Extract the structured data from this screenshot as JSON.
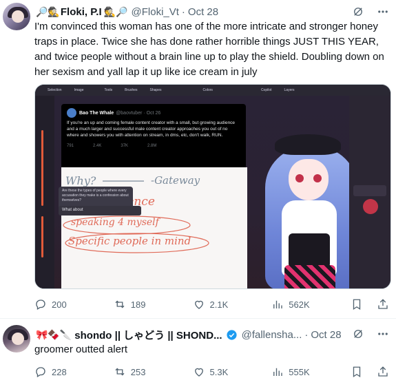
{
  "tweets": [
    {
      "author": {
        "emoji_prefix": "🔎🕵",
        "display_name": "Floki, P.I",
        "emoji_suffix": "🕵🔎",
        "handle": "@Floki_Vt",
        "verified": false
      },
      "date": "Oct 28",
      "text": "I'm convinced this woman has one of the more intricate and stronger honey traps in place. Twice she has done rather horrible things JUST THIS YEAR, and twice people without a brain line up to play the shield.  Doubling down on her sexism and yall lap it up like ice cream in july",
      "media": {
        "toolbar": [
          "Selection",
          "Image",
          "Tools",
          "Brushes",
          "Shapes",
          "Colors",
          "Copilot",
          "Layers"
        ],
        "embedded_tweet": {
          "name": "Bao The Whale",
          "handle": "@baovtuber · Oct 26",
          "body": "If you're an up and coming female content creator with a small, but growing audience and a much larger and successful male content creator approaches you out of no where and showers you with attention on stream, in dms, etc, don't walk, RUN.",
          "stats": [
            "791",
            "2.4K",
            "37K",
            "2.8M"
          ]
        },
        "handwriting": {
          "why": "Why?",
          "gateway": "-Gateway",
          "line1": "my experience",
          "line2": "speaking 4 myself",
          "line3": "Specific people in mind"
        },
        "chat_question": "Are these the types of people where every accusation they make is a confession about themselves?",
        "chat_reply": "What about"
      },
      "stats": {
        "replies": "200",
        "reposts": "189",
        "likes": "2.1K",
        "views": "562K"
      }
    },
    {
      "author": {
        "emoji_prefix": "🎀🍫🔪",
        "display_name": "shondo || しゃどう || SHOND...",
        "handle": "@fallensha...",
        "verified": true
      },
      "date": "Oct 28",
      "text": "groomer outted alert",
      "stats": {
        "replies": "228",
        "reposts": "253",
        "likes": "5.3K",
        "views": "555K"
      }
    }
  ],
  "colors": {
    "text_primary": "#0f1419",
    "text_secondary": "#536471",
    "verified_blue": "#1d9bf0",
    "divider": "#eff3f4"
  },
  "icons": {
    "grok": "grok-icon",
    "more": "more-icon",
    "reply": "reply-icon",
    "repost": "repost-icon",
    "like": "heart-icon",
    "views": "views-icon",
    "bookmark": "bookmark-icon",
    "share": "share-icon"
  }
}
